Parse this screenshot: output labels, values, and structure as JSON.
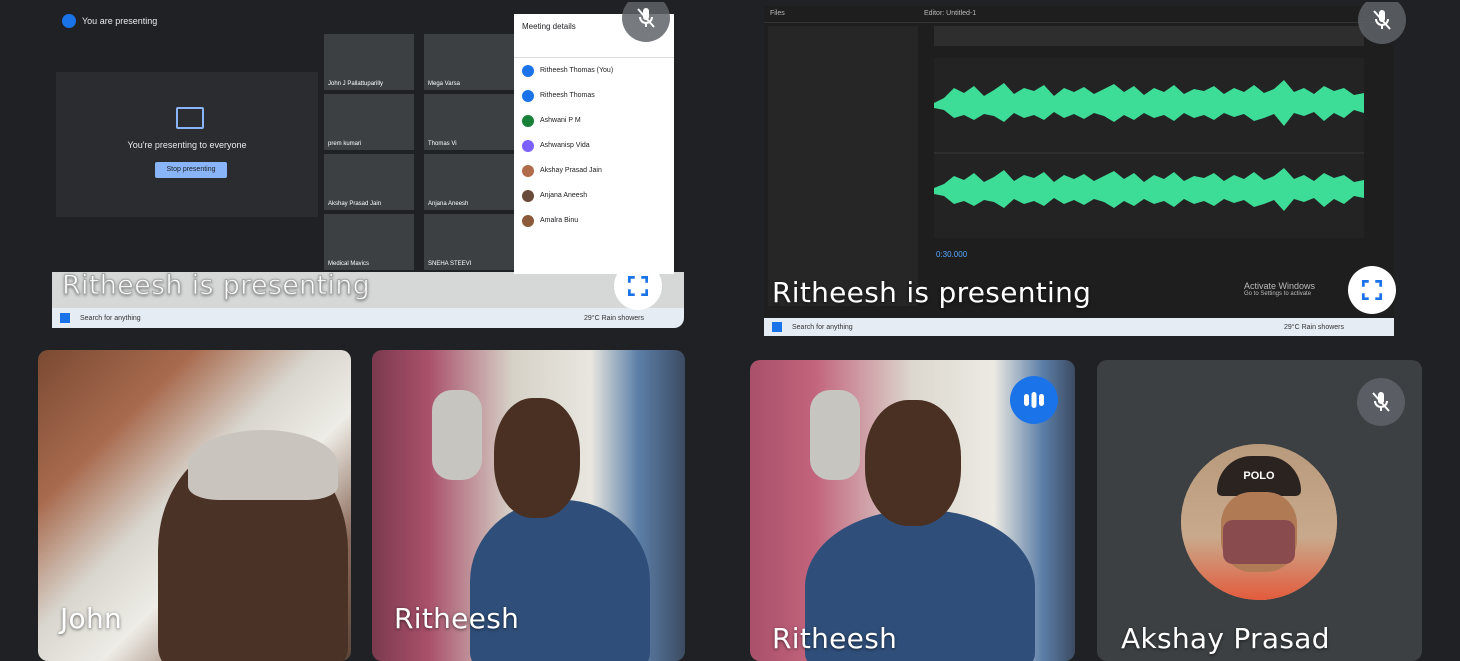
{
  "tiles": {
    "screen1": {
      "presenting_label": "Ritheesh is presenting",
      "inner": {
        "you_are_presenting": "You are presenting",
        "presenting_to_everyone": "You're presenting to everyone",
        "stop_presenting": "Stop presenting",
        "meeting_details": "Meeting details",
        "participants": [
          "Ritheesh Thomas (You)",
          "Ritheesh Thomas",
          "Ashwani P M",
          "Ashwanisp Vida",
          "Akshay Prasad Jain",
          "Anjana Aneesh",
          "Amalra Binu"
        ],
        "mini_tiles": [
          "John J Pallattuparilly",
          "Mega Varsa",
          "prem kumari",
          "Thomas Vi",
          "Akshay Prasad Jain",
          "Anjana Aneesh",
          "Medical Mavics",
          "SNEHA STEEVI"
        ],
        "search_placeholder": "Search for anything",
        "weather": "29°C Rain showers"
      }
    },
    "screen2": {
      "presenting_label": "Ritheesh is presenting",
      "inner": {
        "tab_files": "Files",
        "tab_editor": "Editor: Untitled-1",
        "timecode": "0:30.000",
        "search_placeholder": "Search for anything",
        "weather": "29°C Rain showers",
        "activate_windows": "Activate Windows",
        "activate_windows_sub": "Go to Settings to activate"
      }
    },
    "john": {
      "name": "John"
    },
    "ritheesh_a": {
      "name": "Ritheesh"
    },
    "ritheesh_b": {
      "name": "Ritheesh"
    },
    "akshay": {
      "name": "Akshay Prasad",
      "cap_text": "POLO"
    }
  },
  "icons": {
    "mic_off": "mic-off-icon",
    "fullscreen": "fullscreen-icon",
    "speaking": "audio-level-icon"
  },
  "colors": {
    "background": "#202124",
    "tile": "#3c4043",
    "accent_blue": "#1a73e8",
    "wave_green": "#3ddc97"
  }
}
